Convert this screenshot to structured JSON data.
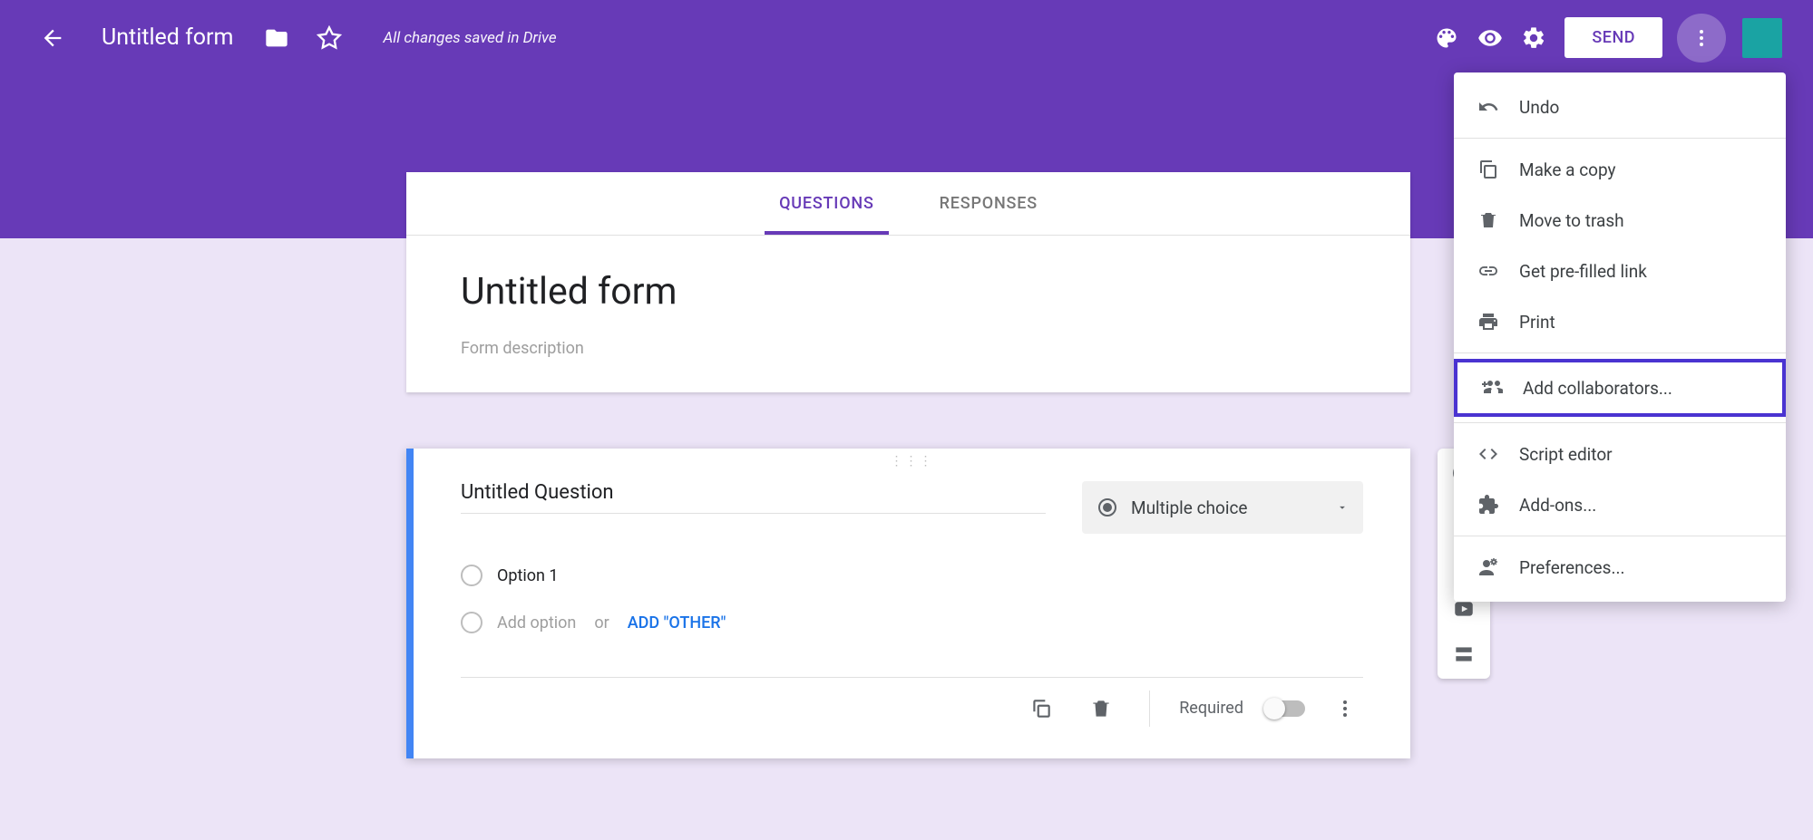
{
  "header": {
    "title": "Untitled form",
    "saved_text": "All changes saved in Drive",
    "send_label": "SEND"
  },
  "tabs": {
    "questions": "QUESTIONS",
    "responses": "RESPONSES"
  },
  "form": {
    "title": "Untitled form",
    "description_placeholder": "Form description"
  },
  "question": {
    "title": "Untitled Question",
    "type_label": "Multiple choice",
    "option1": "Option 1",
    "add_option": "Add option",
    "or": "or",
    "add_other": "ADD \"OTHER\"",
    "required": "Required"
  },
  "menu": {
    "undo": "Undo",
    "make_copy": "Make a copy",
    "move_to_trash": "Move to trash",
    "get_prefilled": "Get pre-filled link",
    "print": "Print",
    "add_collaborators": "Add collaborators...",
    "script_editor": "Script editor",
    "addons": "Add-ons...",
    "preferences": "Preferences..."
  }
}
